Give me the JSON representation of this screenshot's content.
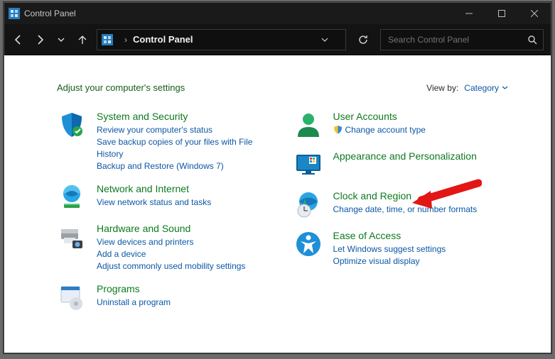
{
  "window": {
    "title": "Control Panel",
    "placeholder_search": "Search Control Panel"
  },
  "addressbar": {
    "location": "Control Panel"
  },
  "header": {
    "heading": "Adjust your computer's settings",
    "view_by_label": "View by:",
    "view_by_value": "Category"
  },
  "left": [
    {
      "title": "System and Security",
      "links": [
        "Review your computer's status",
        "Save backup copies of your files with File History",
        "Backup and Restore (Windows 7)"
      ]
    },
    {
      "title": "Network and Internet",
      "links": [
        "View network status and tasks"
      ]
    },
    {
      "title": "Hardware and Sound",
      "links": [
        "View devices and printers",
        "Add a device",
        "Adjust commonly used mobility settings"
      ]
    },
    {
      "title": "Programs",
      "links": [
        "Uninstall a program"
      ]
    }
  ],
  "right": [
    {
      "title": "User Accounts",
      "links_with_shield": [
        "Change account type"
      ]
    },
    {
      "title": "Appearance and Personalization",
      "links": []
    },
    {
      "title": "Clock and Region",
      "links": [
        "Change date, time, or number formats"
      ]
    },
    {
      "title": "Ease of Access",
      "links": [
        "Let Windows suggest settings",
        "Optimize visual display"
      ]
    }
  ]
}
